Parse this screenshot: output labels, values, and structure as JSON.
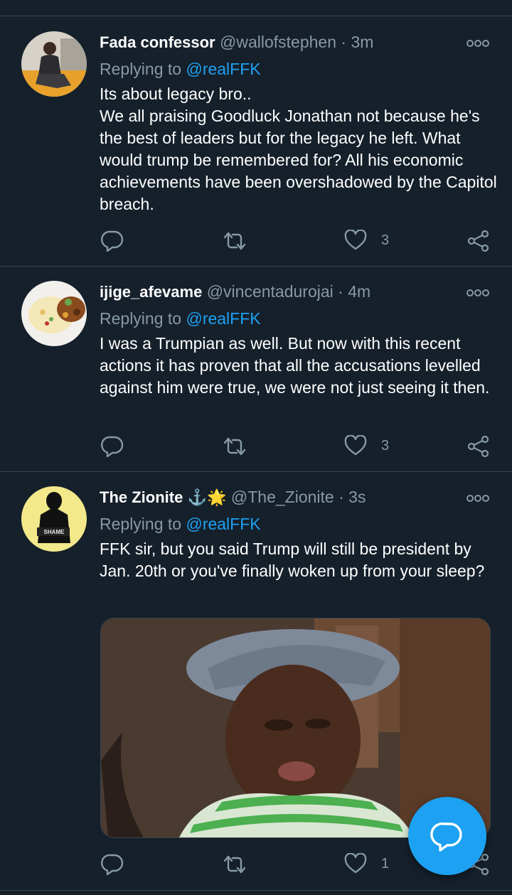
{
  "tweets": [
    {
      "name": "Fada confessor",
      "handle": "@wallofstephen",
      "separator": "·",
      "time": "3m",
      "replying_prefix": "Replying to ",
      "replying_to": "@realFFK",
      "text": "Its about legacy bro..\nWe all praising Goodluck Jonathan not because he's the best of leaders but for the legacy he left. What would trump be remembered for? All his economic achievements have been overshadowed by the Capitol breach.",
      "likes": "3"
    },
    {
      "name": "ijige_afevame",
      "handle": "@vincentadurojai",
      "separator": "·",
      "time": "4m",
      "replying_prefix": "Replying to ",
      "replying_to": "@realFFK",
      "text": "I was a Trumpian as well. But now with this recent actions it has proven that all the accusations levelled against him were true, we were not just seeing it then.",
      "likes": "3"
    },
    {
      "name": "The Zionite",
      "name_emoji": "⚓🌟",
      "handle": "@The_Zionite",
      "separator": "·",
      "time": "3s",
      "replying_prefix": "Replying to ",
      "replying_to": "@realFFK",
      "text": "FFK sir, but you said Trump will still be president by Jan. 20th or you've finally woken up from your sleep?",
      "likes": "1",
      "avatar_text": "SHAME"
    }
  ],
  "colors": {
    "background": "#15202b",
    "divider": "#38444d",
    "secondary_text": "#8899a6",
    "accent": "#1da1f2"
  },
  "icons": [
    "reply-icon",
    "retweet-icon",
    "like-icon",
    "share-icon",
    "more-icon",
    "compose-reply-icon"
  ]
}
